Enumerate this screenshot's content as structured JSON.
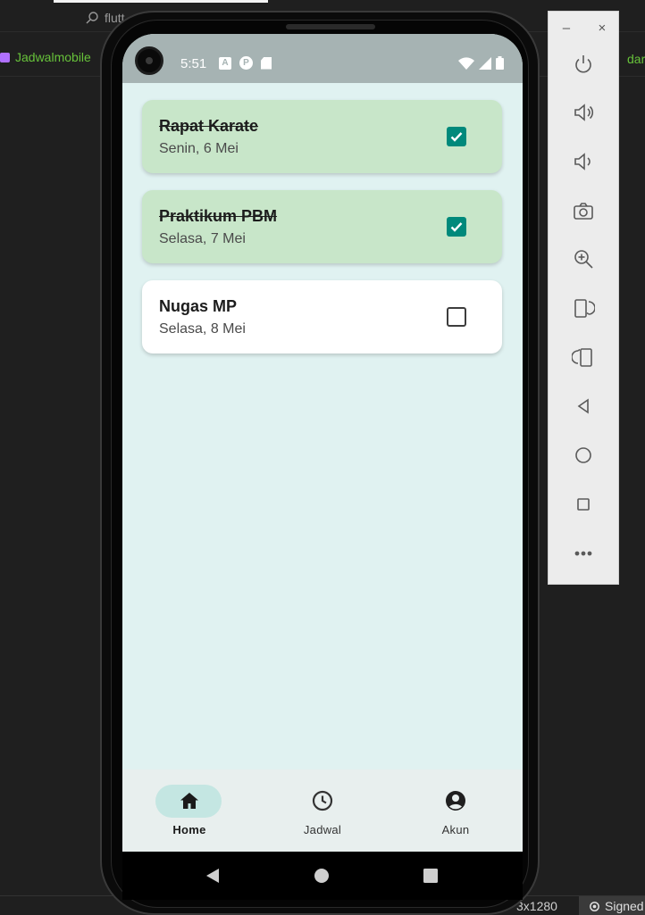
{
  "ide": {
    "search_text": "flutt",
    "project_tab": "Jadwalmobile",
    "right_tab_fragment": "dart",
    "status_resolution": "3x1280",
    "status_signed": "Signed"
  },
  "emulator_toolbar": {
    "minimize": "–",
    "close": "×",
    "tools": [
      "power-icon",
      "volume-up-icon",
      "volume-down-icon",
      "camera-icon",
      "zoom-in-icon",
      "rotate-left-icon",
      "rotate-right-icon",
      "back-icon",
      "home-icon",
      "overview-icon",
      "more-icon"
    ]
  },
  "status_bar": {
    "time": "5:51",
    "icons": [
      "a-notification-icon",
      "app-notification-icon",
      "sd-card-icon",
      "wifi-icon",
      "signal-icon",
      "battery-icon"
    ]
  },
  "tasks": [
    {
      "title": "Rapat Karate",
      "date": "Senin, 6 Mei",
      "done": true
    },
    {
      "title": "Praktikum PBM",
      "date": "Selasa, 7 Mei",
      "done": true
    },
    {
      "title": "Nugas MP",
      "date": "Selasa, 8 Mei",
      "done": false
    }
  ],
  "bottom_nav": {
    "items": [
      {
        "label": "Home",
        "icon": "home-icon",
        "active": true
      },
      {
        "label": "Jadwal",
        "icon": "clock-icon",
        "active": false
      },
      {
        "label": "Akun",
        "icon": "account-icon",
        "active": false
      }
    ]
  },
  "colors": {
    "screen_bg": "#e0f2f1",
    "done_card": "#c8e6c9",
    "checkbox_accent": "#00897b",
    "status_bar": "#a6b3b3",
    "nav_bg": "#e8efee",
    "nav_active_pill": "#c4e6e2"
  }
}
